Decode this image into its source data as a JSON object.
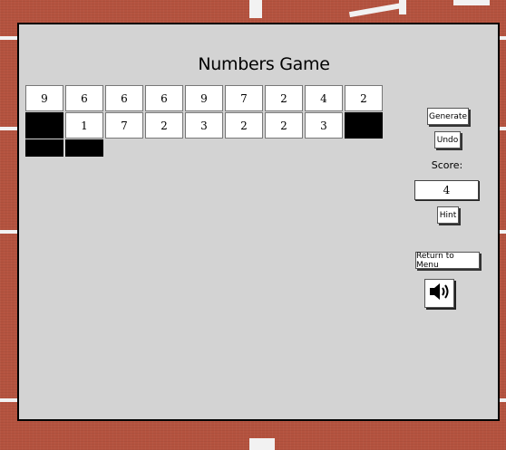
{
  "title": "Numbers Game",
  "grid": {
    "rows": [
      [
        "9",
        "6",
        "6",
        "6",
        "9",
        "7",
        "2",
        "4",
        "2"
      ],
      [
        "",
        "1",
        "7",
        "2",
        "3",
        "2",
        "2",
        "3",
        ""
      ]
    ],
    "blank_cells": [
      [
        1,
        0
      ],
      [
        1,
        8
      ],
      [
        2,
        0
      ],
      [
        2,
        1
      ]
    ]
  },
  "controls": {
    "generate_label": "Generate",
    "undo_label": "Undo",
    "score_label": "Score:",
    "score_value": "4",
    "hint_label": "Hint",
    "menu_label": "Return to Menu",
    "sound_icon": "speaker-icon"
  },
  "colors": {
    "panel_bg": "#d3d3d3",
    "track_bg": "#b5533f",
    "blank_cell": "#000000"
  }
}
